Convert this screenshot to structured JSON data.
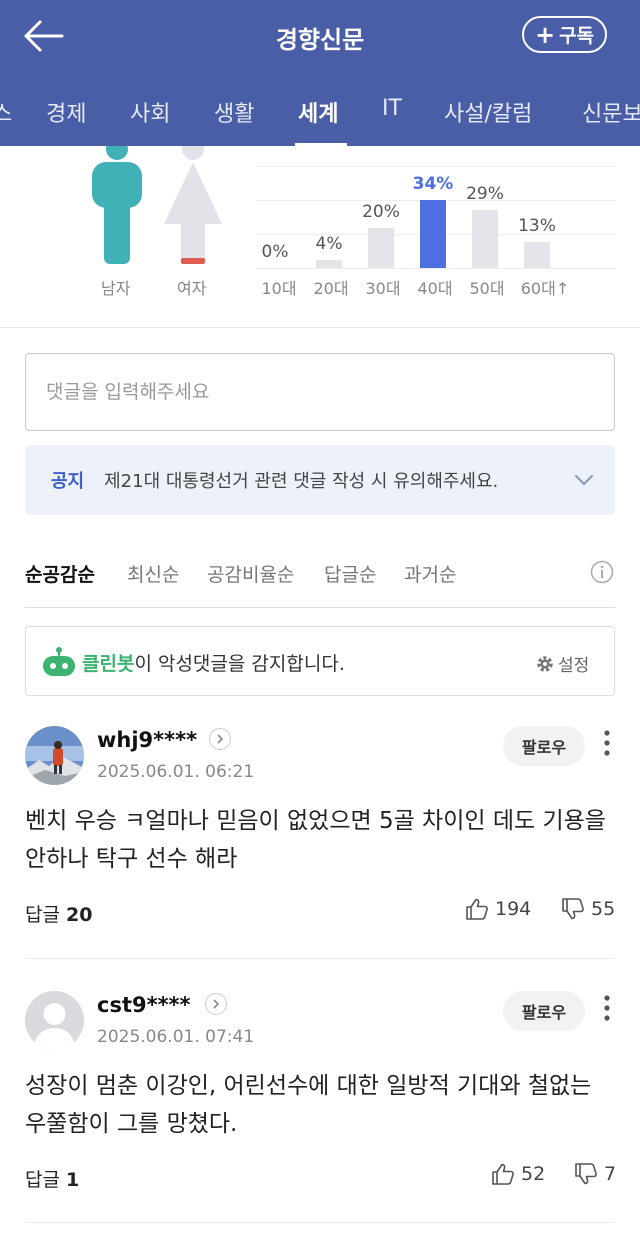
{
  "header": {
    "title": "경향신문",
    "subscribe_label": "구독",
    "tabs": [
      "스",
      "경제",
      "사회",
      "생활",
      "세계",
      "IT",
      "사설/칼럼",
      "신문보"
    ],
    "active_tab": "세계"
  },
  "stats": {
    "gender": {
      "male_label": "남자",
      "female_label": "여자"
    },
    "ages": [
      {
        "label": "10대",
        "pct": "0%",
        "value": 0
      },
      {
        "label": "20대",
        "pct": "4%",
        "value": 4
      },
      {
        "label": "30대",
        "pct": "20%",
        "value": 20
      },
      {
        "label": "40대",
        "pct": "34%",
        "value": 34
      },
      {
        "label": "50대",
        "pct": "29%",
        "value": 29
      },
      {
        "label": "60대↑",
        "pct": "13%",
        "value": 13
      }
    ],
    "highlight_color": "#4d6fe0",
    "bar_color": "#e3e5ea"
  },
  "comment_input": {
    "placeholder": "댓글을 입력해주세요"
  },
  "notice": {
    "tag": "공지",
    "text": "제21대 대통령선거 관련 댓글 작성 시 유의해주세요."
  },
  "sort": {
    "items": [
      "순공감순",
      "최신순",
      "공감비율순",
      "답글순",
      "과거순"
    ],
    "active": "순공감순"
  },
  "cleanbot": {
    "name": "클린봇",
    "text": "이 악성댓글을 감지합니다.",
    "settings_label": "설정"
  },
  "comments": [
    {
      "user": "whj9****",
      "date": "2025.06.01. 06:21",
      "follow_label": "팔로우",
      "text": "벤치 우승 ㅋ얼마나 믿음이 없었으면 5골 차이인 데도 기용을 안하나 탁구 선수 해라",
      "reply_label": "답글",
      "reply_count": "20",
      "likes": "194",
      "dislikes": "55"
    },
    {
      "user": "cst9****",
      "date": "2025.06.01. 07:41",
      "follow_label": "팔로우",
      "text": "성장이 멈춘 이강인, 어린선수에 대한 일방적 기대와 철없는 우쭐함이 그를 망쳤다.",
      "reply_label": "답글",
      "reply_count": "1",
      "likes": "52",
      "dislikes": "7"
    }
  ],
  "colors": {
    "header_bg": "#4a5ea8",
    "accent_blue": "#3d5fc6",
    "cleanbot_green": "#3cb371"
  }
}
